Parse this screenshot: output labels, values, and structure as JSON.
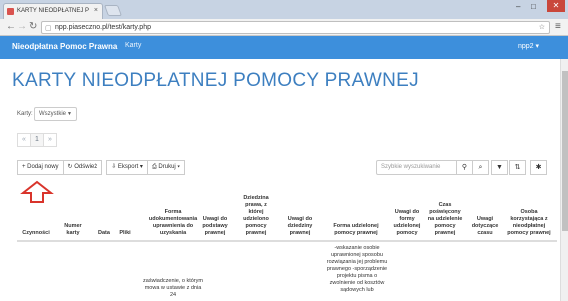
{
  "browser": {
    "tab_title": "KARTY NIEODPŁATNEJ P",
    "tab_close": "×",
    "url": "npp.piaseczno.pl/test/karty.php",
    "window_controls": {
      "minimize": "–",
      "maximize": "□",
      "close": "✕"
    }
  },
  "navbar": {
    "brand": "Nieodpłatna Pomoc Prawna",
    "link_karty": "Karty",
    "user": "npp2 ▾"
  },
  "page": {
    "title": "KARTY NIEODPŁATNEJ POMOCY PRAWNEJ",
    "filter_label": "Karty:",
    "filter_value": "Wszystkie",
    "pager": {
      "prev": "«",
      "current": "1",
      "next": "»"
    }
  },
  "toolbar": {
    "add": "+ Dodaj nowy",
    "refresh": "↻ Odśwież",
    "export": "⇩ Eksport ▾",
    "print": "⎙ Drukuj ▾",
    "search_placeholder": "Szybkie wyszukiwanie",
    "search_icon": "search-icon",
    "zoom_icon": "zoom-icon",
    "filter_icon": "filter-icon",
    "sort_icon": "sort-icon",
    "settings_icon": "gear-icon"
  },
  "table": {
    "headers": {
      "czynnosci": "Czynności",
      "numer_karty": "Numer karty",
      "data": "Data",
      "pliki": "Pliki",
      "forma_udokumentowania": "Forma udokumentowania uprawnienia do uzyskania",
      "uwagi_podstawy": "Uwagi do podstawy prawnej",
      "dziedzina": "Dziedzina prawa, z której udzielono pomocy prawnej",
      "uwagi_dziedziny": "Uwagi do dziedziny prawnej",
      "forma_pomocy": "Forma udzielonej pomocy prawnej",
      "uwagi_formy": "Uwagi do formy udzielonej pomocy",
      "czas": "Czas poświęcony na udzielenie pomocy prawnej",
      "uwagi_czasu": "Uwagi dotyczące czasu",
      "osoba": "Osoba korzystająca z nieodpłatnej pomocy prawnej"
    },
    "row1": {
      "forma_udokumentowania": "zaświadczenie, o którym mowa w ustawie z dnia 24",
      "forma_pomocy": "-wskazanie osobie uprawnionej sposobu rozwiązania jej problemu prawnego -sporządzenie projektu pisma o zwolnienie od kosztów sądowych lub"
    }
  },
  "colors": {
    "navbar": "#3d8fdc",
    "title": "#3d7fc0",
    "arrow": "#d9342b"
  }
}
